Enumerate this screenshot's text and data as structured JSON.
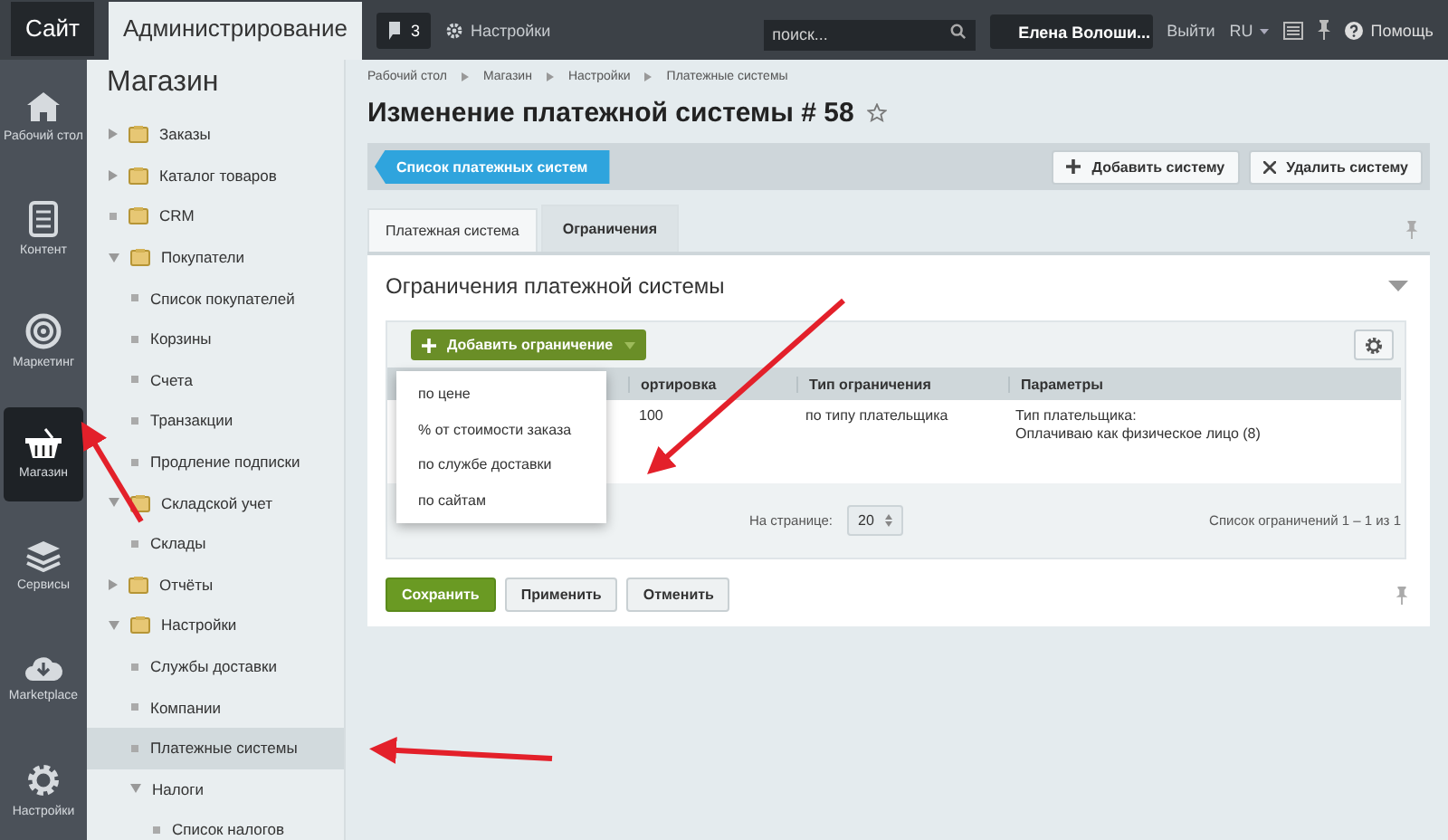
{
  "topbar": {
    "tabs": [
      {
        "label": "Сайт",
        "selected": false
      },
      {
        "label": "Администрирование",
        "selected": true
      }
    ],
    "notifications": "3",
    "settings": "Настройки",
    "search": {
      "placeholder": "поиск..."
    },
    "user": "Елена Волоши...",
    "logout": "Выйти",
    "language": "RU",
    "help": "Помощь"
  },
  "nav": [
    {
      "label": "Рабочий стол",
      "selected": false
    },
    {
      "label": "Контент",
      "selected": false
    },
    {
      "label": "Маркетинг",
      "selected": false
    },
    {
      "label": "Магазин",
      "selected": true
    },
    {
      "label": "Сервисы",
      "selected": false
    },
    {
      "label": "Marketplace",
      "selected": false
    },
    {
      "label": "Настройки",
      "selected": false
    }
  ],
  "sidebar": {
    "title": "Магазин",
    "items": [
      {
        "label": "Заказы",
        "kind": "group",
        "expanded": false,
        "selected": false
      },
      {
        "label": "Каталог товаров",
        "kind": "group",
        "expanded": false,
        "selected": false
      },
      {
        "label": "CRM",
        "kind": "leaf",
        "selected": false
      },
      {
        "label": "Покупатели",
        "kind": "group",
        "expanded": true,
        "selected": false,
        "children": [
          {
            "label": "Список покупателей",
            "kind": "leaf",
            "selected": false
          },
          {
            "label": "Корзины",
            "kind": "leaf",
            "selected": false
          },
          {
            "label": "Счета",
            "kind": "leaf",
            "selected": false
          },
          {
            "label": "Транзакции",
            "kind": "leaf",
            "selected": false
          },
          {
            "label": "Продление подписки",
            "kind": "leaf",
            "selected": false
          }
        ]
      },
      {
        "label": "Складской учет",
        "kind": "group",
        "expanded": true,
        "selected": false,
        "children": [
          {
            "label": "Склады",
            "kind": "leaf",
            "selected": false
          }
        ]
      },
      {
        "label": "Отчёты",
        "kind": "group",
        "expanded": false,
        "selected": false
      },
      {
        "label": "Настройки",
        "kind": "group",
        "expanded": true,
        "selected": false,
        "children": [
          {
            "label": "Службы доставки",
            "kind": "leaf",
            "selected": false
          },
          {
            "label": "Компании",
            "kind": "leaf",
            "selected": false
          },
          {
            "label": "Платежные системы",
            "kind": "leaf",
            "selected": true
          },
          {
            "label": "Налоги",
            "kind": "group",
            "expanded": true,
            "selected": false,
            "children": [
              {
                "label": "Список налогов",
                "kind": "leaf",
                "selected": false
              }
            ]
          }
        ]
      }
    ]
  },
  "breadcrumbs": [
    "Рабочий стол",
    "Магазин",
    "Настройки",
    "Платежные системы"
  ],
  "title": "Изменение платежной системы # 58",
  "toolbar": {
    "back": "Список платежных систем",
    "buttons": [
      {
        "label": "Добавить систему",
        "kind": "add"
      },
      {
        "label": "Удалить систему",
        "kind": "delete"
      }
    ]
  },
  "tabs": [
    {
      "label": "Платежная система",
      "selected": false
    },
    {
      "label": "Ограничения",
      "selected": true
    }
  ],
  "panel": {
    "title": "Ограничения платежной системы",
    "add_button": "Добавить ограничение",
    "menu": [
      "по цене",
      "% от стоимости заказа",
      "по службе доставки",
      "по сайтам"
    ],
    "table": {
      "columns": [
        "ортировка",
        "Тип ограничения",
        "Параметры"
      ],
      "rows": [
        {
          "cells": [
            "100",
            "по типу плательщика",
            "Тип плательщика:\nОплачиваю как физическое лицо (8)"
          ]
        }
      ]
    },
    "per_page_label": "На странице:",
    "per_page": "20",
    "summary": "Список ограничений 1 – 1 из 1"
  },
  "buttons": [
    {
      "label": "Сохранить",
      "kind": "primary"
    },
    {
      "label": "Применить",
      "kind": "normal"
    },
    {
      "label": "Отменить",
      "kind": "normal"
    }
  ]
}
